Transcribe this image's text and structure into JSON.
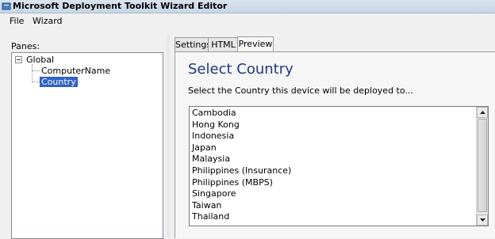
{
  "window": {
    "title": "Microsoft Deployment Toolkit Wizard Editor",
    "icon": "mdt-app-icon"
  },
  "menu": {
    "items": [
      "File",
      "Wizard"
    ]
  },
  "panes": {
    "label": "Panes:",
    "tree": {
      "root": "Global",
      "children": [
        "ComputerName",
        "Country"
      ],
      "selected": "Country"
    }
  },
  "tabs": {
    "items": [
      "Settings",
      "HTML",
      "Preview"
    ],
    "active": "Preview"
  },
  "preview": {
    "heading": "Select Country",
    "instruction": "Select the Country this device will be deployed to...",
    "countries": [
      "Cambodia",
      "Hong Kong",
      "Indonesia",
      "Japan",
      "Malaysia",
      "Philippines (Insurance)",
      "Philippines (MBPS)",
      "Singapore",
      "Taiwan",
      "Thailand"
    ]
  },
  "colors": {
    "heading": "#1f3a7a",
    "selection": "#3162c4"
  }
}
